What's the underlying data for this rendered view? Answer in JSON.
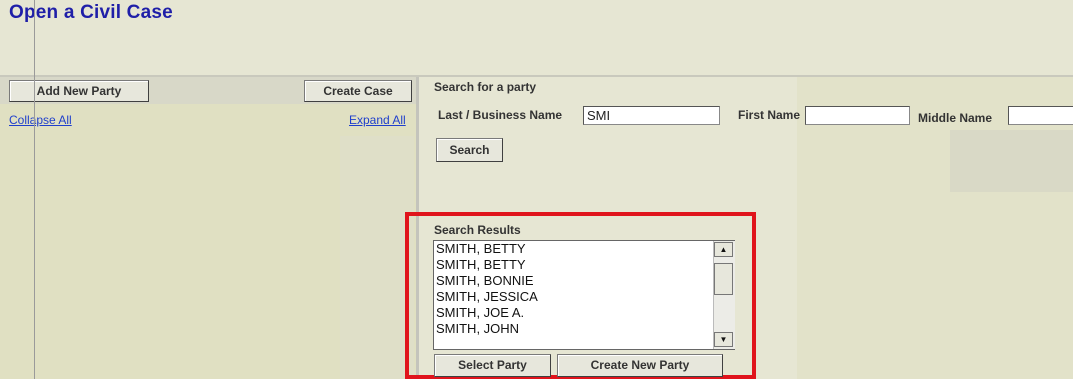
{
  "page": {
    "title": "Open a Civil Case"
  },
  "left_panel": {
    "add_party_button": "Add New Party",
    "create_case_button": "Create Case",
    "collapse_all": "Collapse All",
    "expand_all": "Expand All"
  },
  "search": {
    "heading": "Search for a party",
    "last_name_label": "Last / Business Name",
    "last_name_value": "SMI",
    "first_name_label": "First Name",
    "first_name_value": "",
    "middle_name_label": "Middle Name",
    "middle_name_value": "",
    "search_button": "Search"
  },
  "results": {
    "heading": "Search Results",
    "items": [
      "SMITH, BETTY",
      "SMITH, BETTY",
      "SMITH, BONNIE",
      "SMITH, JESSICA",
      "SMITH, JOE A.",
      "SMITH, JOHN"
    ],
    "select_button": "Select Party",
    "create_button": "Create New Party"
  },
  "colors": {
    "title": "#1f1fa8",
    "highlight": "#e0141c",
    "link": "#1f3fcc"
  }
}
